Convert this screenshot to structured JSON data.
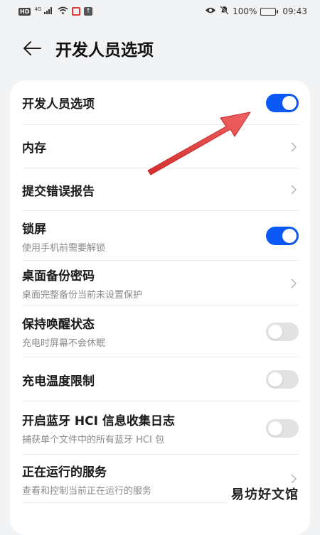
{
  "status_bar": {
    "hd": "HD",
    "network": "4G",
    "battery_pct": "100%",
    "time": "09:43"
  },
  "header": {
    "title": "开发人员选项"
  },
  "rows": [
    {
      "title": "开发人员选项",
      "subtitle": "",
      "control": "toggle",
      "on": true
    },
    {
      "title": "内存",
      "subtitle": "",
      "control": "chevron"
    },
    {
      "title": "提交错误报告",
      "subtitle": "",
      "control": "chevron"
    },
    {
      "title": "锁屏",
      "subtitle": "使用手机前需要解锁",
      "control": "toggle",
      "on": true
    },
    {
      "title": "桌面备份密码",
      "subtitle": "桌面完整备份当前未设置保护",
      "control": "chevron"
    },
    {
      "title": "保持唤醒状态",
      "subtitle": "充电时屏幕不会休眠",
      "control": "toggle",
      "on": false
    },
    {
      "title": "充电温度限制",
      "subtitle": "",
      "control": "toggle",
      "on": false
    },
    {
      "title": "开启蓝牙 HCI 信息收集日志",
      "subtitle": "捕获单个文件中的所有蓝牙 HCI 包",
      "control": "toggle",
      "on": false
    },
    {
      "title": "正在运行的服务",
      "subtitle": "查看和控制当前正在运行的服务",
      "control": "chevron"
    }
  ],
  "watermark": "易坊好文馆",
  "colors": {
    "accent": "#0a59f7",
    "annotation_arrow": "#e53935"
  }
}
